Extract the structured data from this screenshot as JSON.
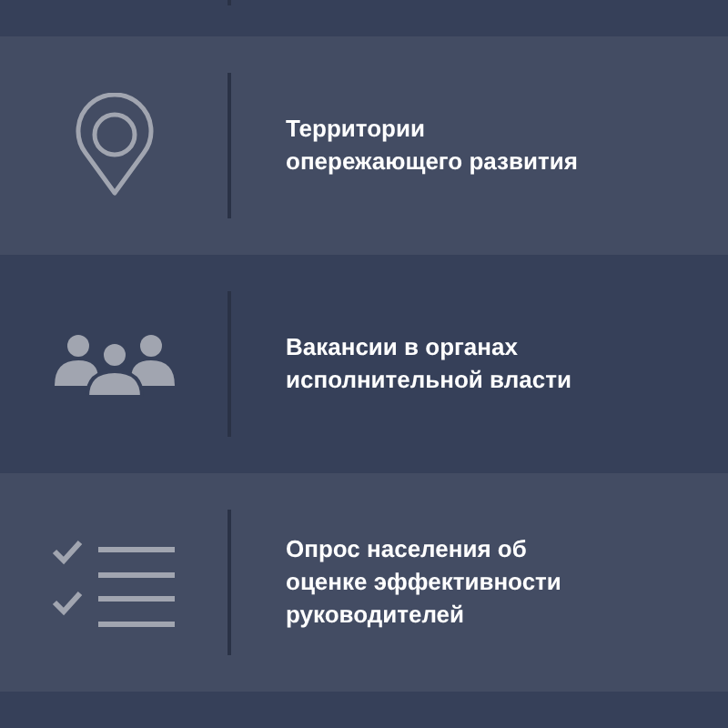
{
  "items": [
    {
      "kind": "pin",
      "label": "Территории опережающего развития"
    },
    {
      "kind": "people",
      "label": "Вакансии в органах исполнительной власти"
    },
    {
      "kind": "checklist",
      "label": "Опрос населения об оценке эффективности руководителей"
    }
  ]
}
